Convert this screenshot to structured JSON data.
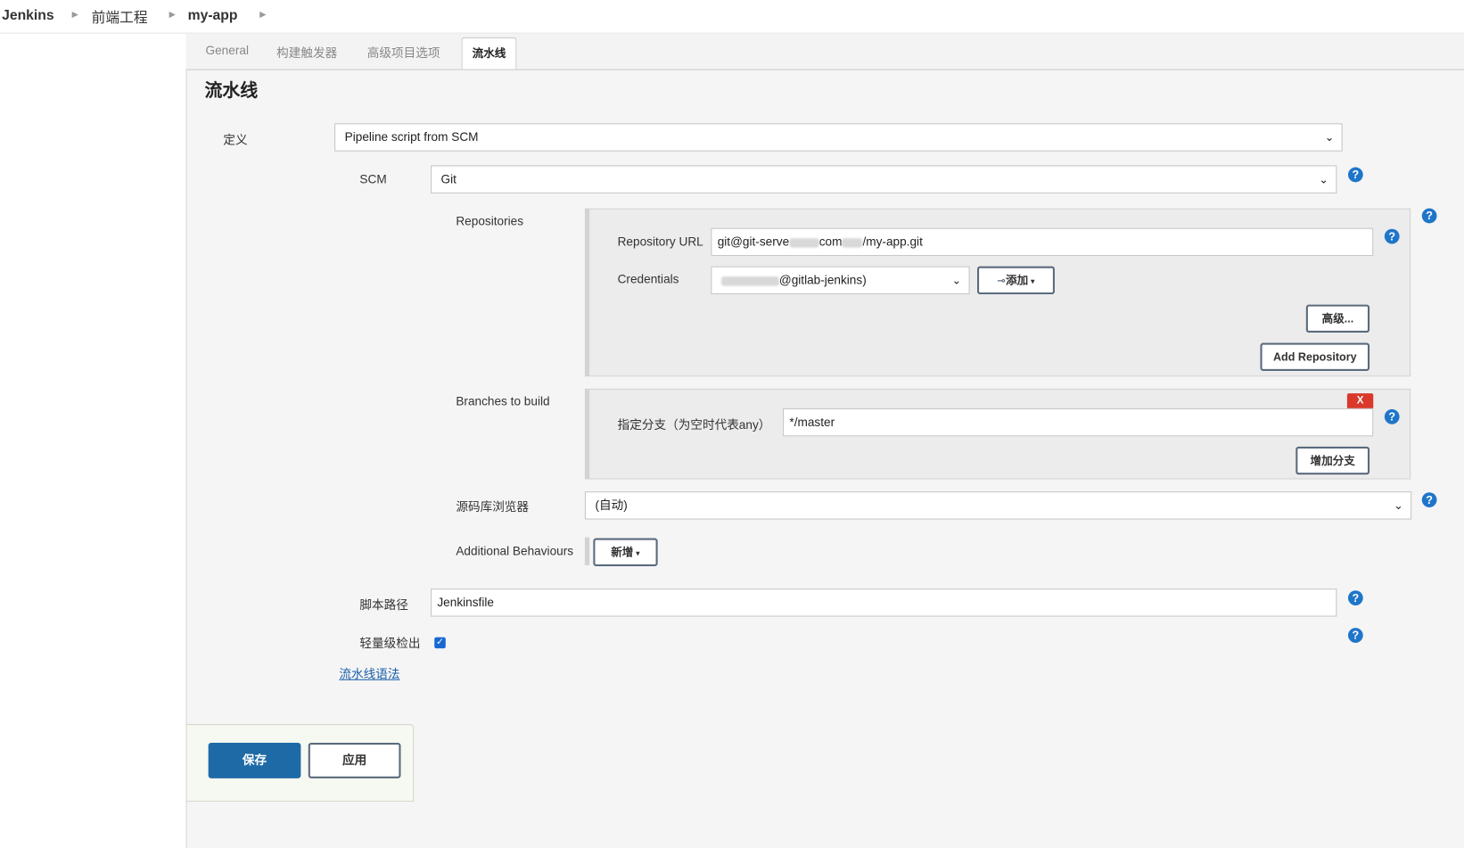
{
  "breadcrumb": {
    "items": [
      "Jenkins",
      "前端工程",
      "my-app"
    ]
  },
  "tabs": [
    {
      "label": "General"
    },
    {
      "label": "构建触发器"
    },
    {
      "label": "高级项目选项"
    },
    {
      "label": "流水线",
      "active": true
    }
  ],
  "section": {
    "title": "流水线"
  },
  "definition": {
    "label": "定义",
    "value": "Pipeline script from SCM"
  },
  "scm": {
    "label": "SCM",
    "value": "Git"
  },
  "repositories": {
    "label": "Repositories",
    "url_label": "Repository URL",
    "url_value_prefix": "git@git-serve",
    "url_value_mid": "com",
    "url_value_suffix": "/my-app.git",
    "credentials_label": "Credentials",
    "credentials_value": "@gitlab-jenkins)",
    "add_button": "添加",
    "advanced_button": "高级...",
    "add_repo_button": "Add Repository"
  },
  "branches": {
    "label": "Branches to build",
    "remove_button": "X",
    "spec_label": "指定分支（为空时代表any）",
    "spec_value": "*/master",
    "add_branch_button": "增加分支"
  },
  "browser": {
    "label": "源码库浏览器",
    "value": "(自动)"
  },
  "behaviours": {
    "label": "Additional Behaviours",
    "add_button": "新增"
  },
  "script_path": {
    "label": "脚本路径",
    "value": "Jenkinsfile"
  },
  "lightweight": {
    "label": "轻量级检出",
    "checked": true
  },
  "syntax_link": "流水线语法",
  "footer": {
    "save": "保存",
    "apply": "应用"
  },
  "help_symbol": "?",
  "colors": {
    "primary": "#1e6aa6",
    "help": "#1f76c9",
    "danger": "#d9382a",
    "link": "#1a5fa8"
  }
}
